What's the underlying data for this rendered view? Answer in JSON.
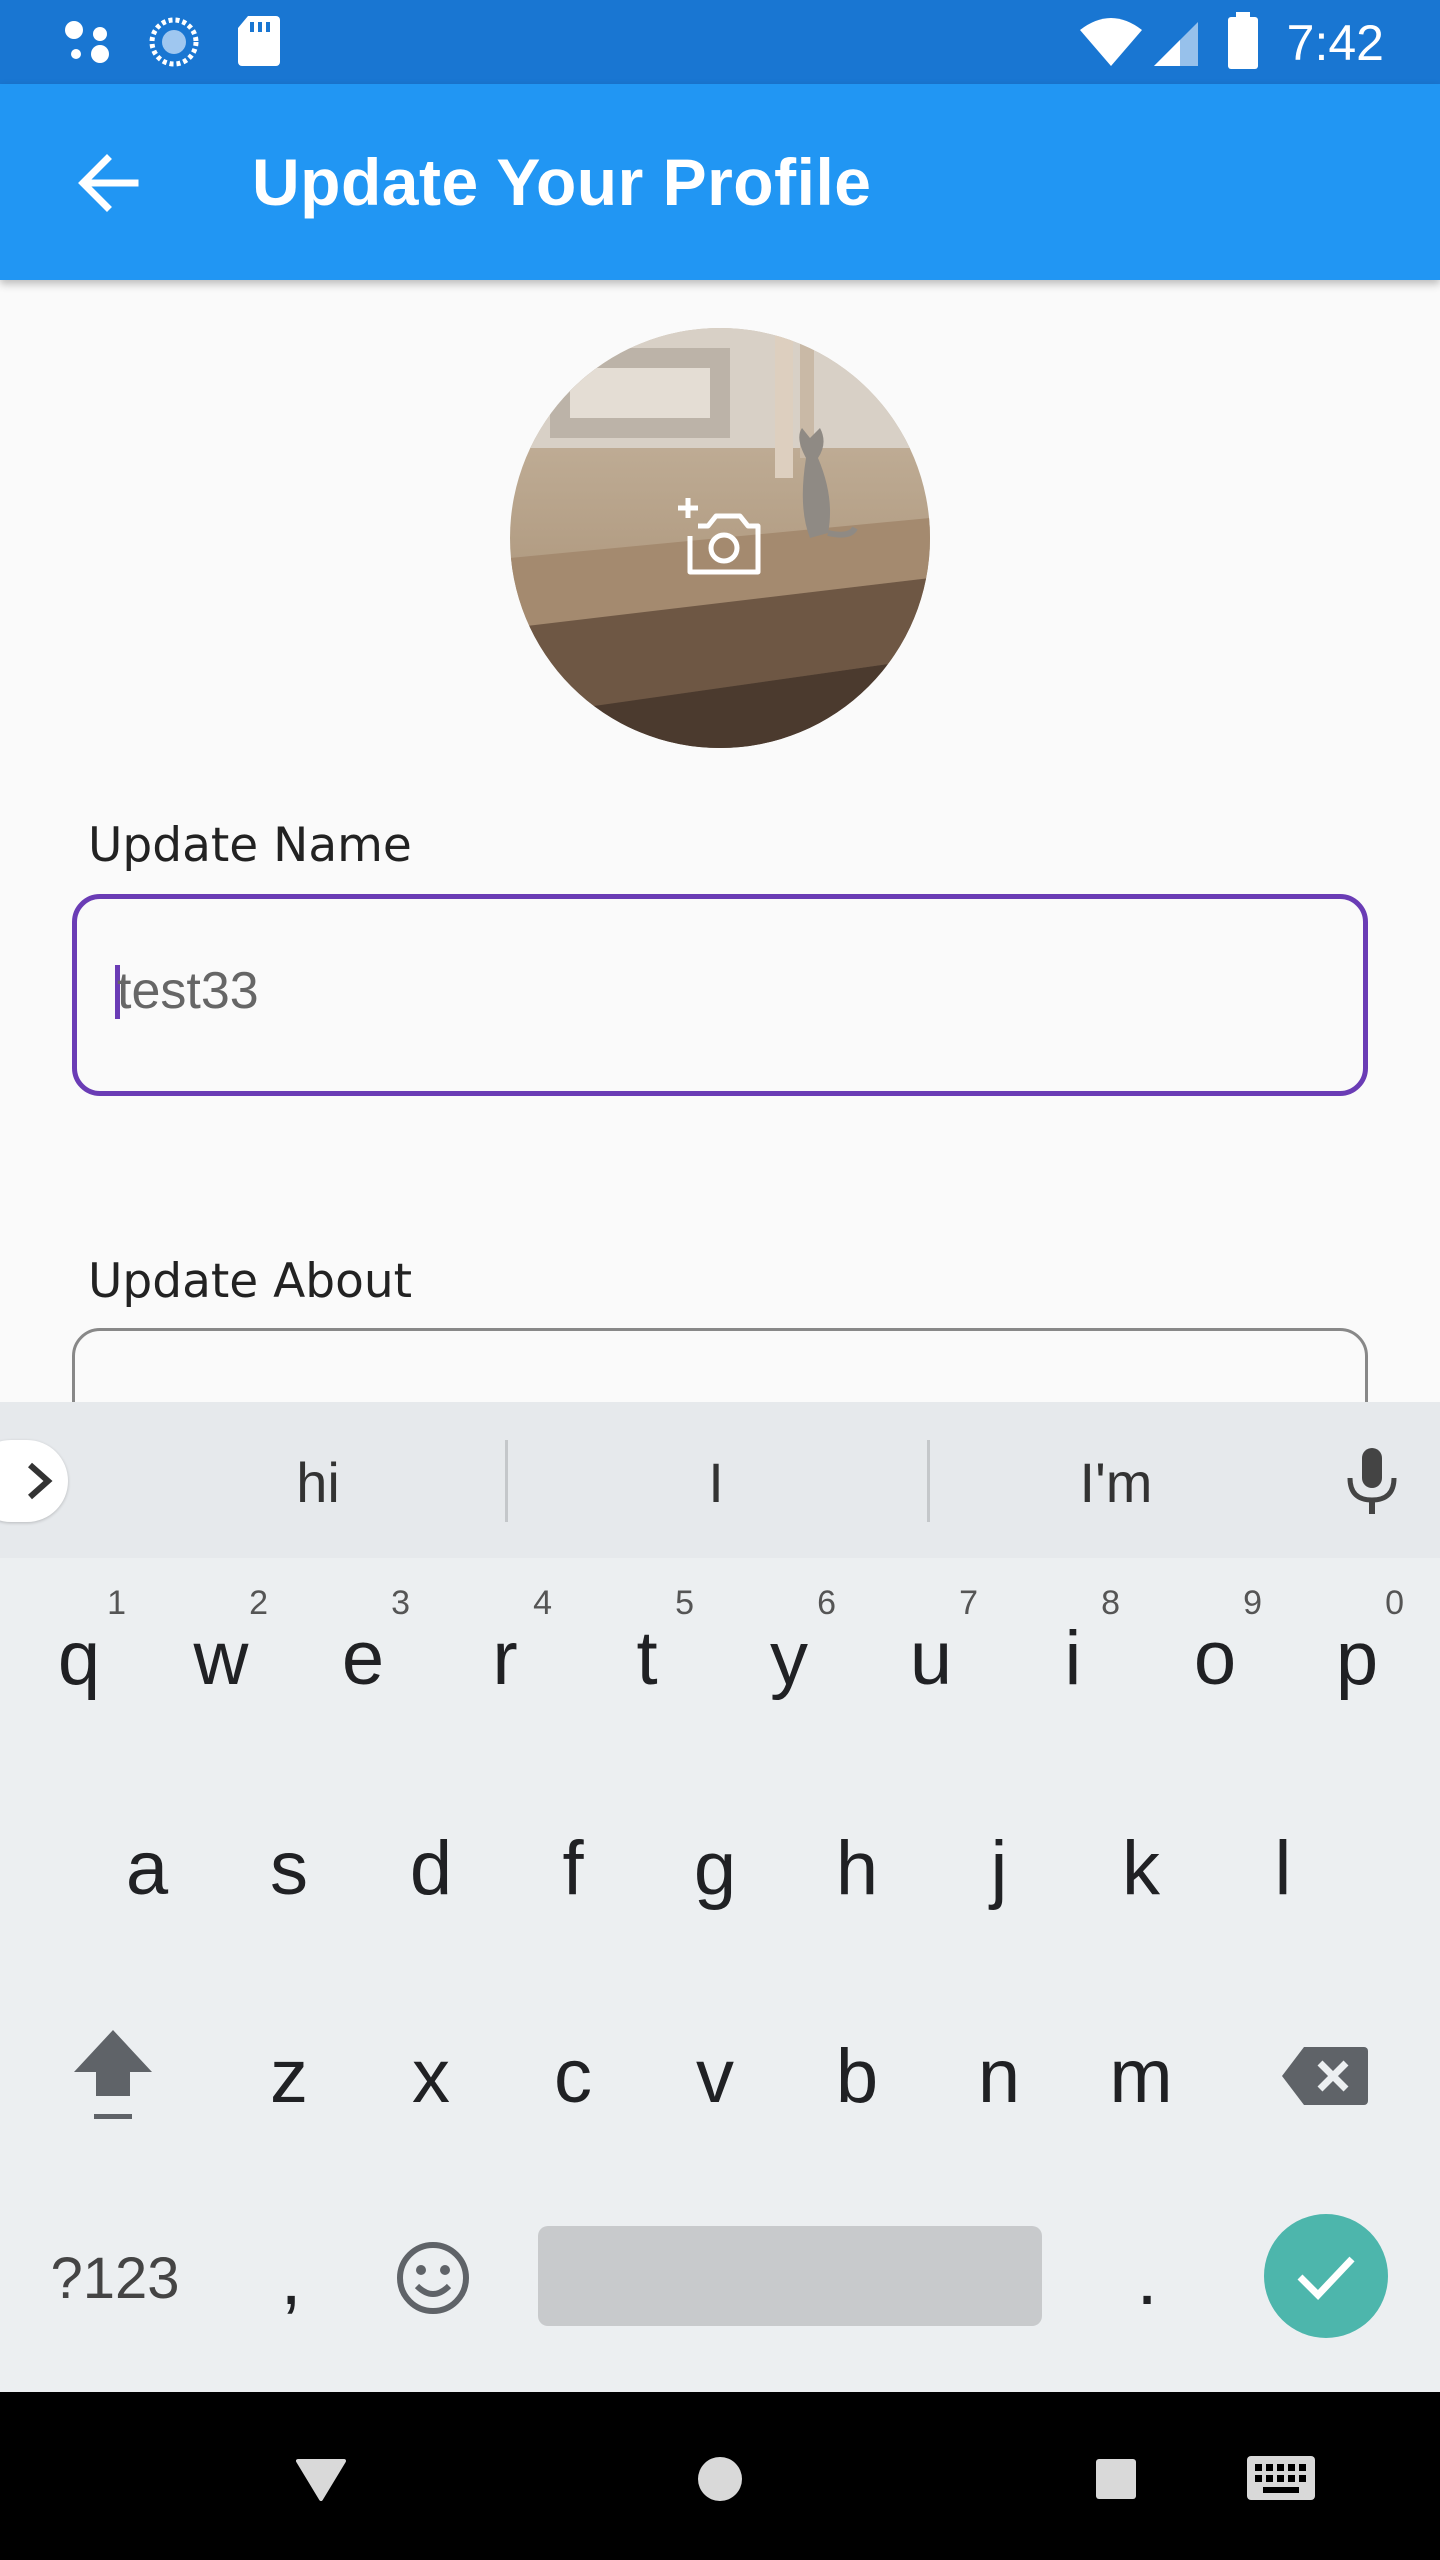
{
  "status_bar": {
    "time": "7:42",
    "left_icons": [
      "assistant-dots-icon",
      "sync-circle-icon",
      "sd-card-icon"
    ],
    "right_icons": [
      "wifi-icon",
      "cell-signal-icon",
      "battery-icon"
    ]
  },
  "app_bar": {
    "title": "Update Your Profile",
    "back_icon": "arrow-back-icon",
    "color": "#2196f3"
  },
  "avatar": {
    "overlay_icon": "add-camera-icon"
  },
  "fields": {
    "name_label": "Update Name",
    "name_value": "test33",
    "about_label": "Update About",
    "focus_color": "#6a3cb5"
  },
  "keyboard": {
    "suggestions": [
      "hi",
      "I",
      "I'm"
    ],
    "row1": [
      {
        "key": "q",
        "hint": "1"
      },
      {
        "key": "w",
        "hint": "2"
      },
      {
        "key": "e",
        "hint": "3"
      },
      {
        "key": "r",
        "hint": "4"
      },
      {
        "key": "t",
        "hint": "5"
      },
      {
        "key": "y",
        "hint": "6"
      },
      {
        "key": "u",
        "hint": "7"
      },
      {
        "key": "i",
        "hint": "8"
      },
      {
        "key": "o",
        "hint": "9"
      },
      {
        "key": "p",
        "hint": "0"
      }
    ],
    "row2": [
      "a",
      "s",
      "d",
      "f",
      "g",
      "h",
      "j",
      "k",
      "l"
    ],
    "row3": [
      "z",
      "x",
      "c",
      "v",
      "b",
      "n",
      "m"
    ],
    "symbols_label": "?123",
    "comma_label": ",",
    "period_label": ".",
    "enter_color": "#4db6ac"
  },
  "nav_bar": {
    "buttons": [
      "back-triangle-icon",
      "home-circle-icon",
      "recents-square-icon",
      "keyboard-switch-icon"
    ]
  }
}
